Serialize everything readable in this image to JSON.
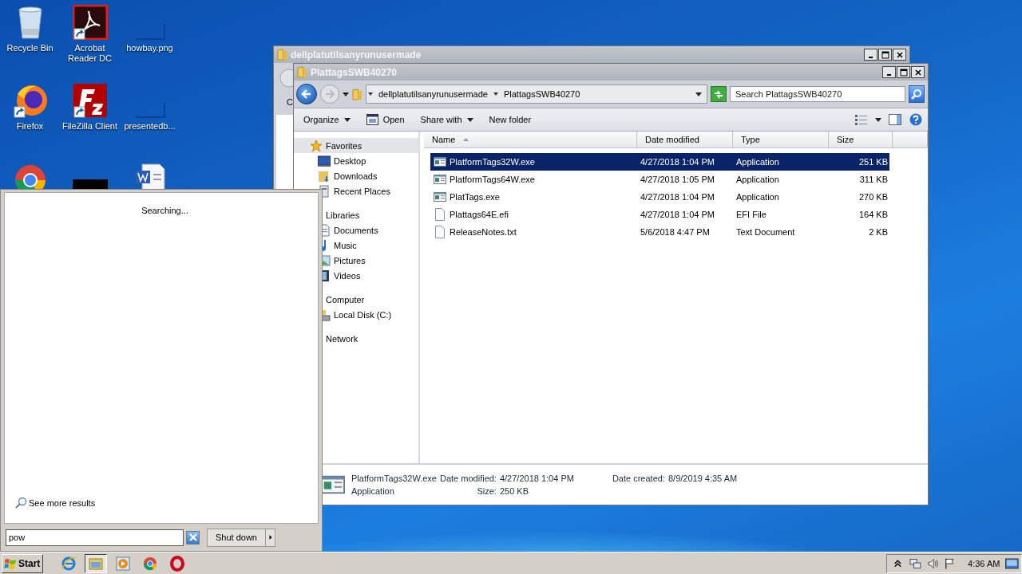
{
  "desktop": {
    "icons": [
      {
        "kind": "recycle",
        "label": "Recycle Bin"
      },
      {
        "kind": "acrobat",
        "label": "Acrobat Reader DC"
      },
      {
        "kind": "blank",
        "label": "howbay.png"
      },
      {
        "kind": "firefox",
        "label": "Firefox"
      },
      {
        "kind": "filezilla",
        "label": "FileZilla Client"
      },
      {
        "kind": "blank",
        "label": "presentedb..."
      },
      {
        "kind": "chrome"
      },
      {
        "kind": "black"
      },
      {
        "kind": "word"
      }
    ]
  },
  "back_window": {
    "title": "dellplatutilsanyrunusermade",
    "toolbar_fragment": "C"
  },
  "explorer": {
    "title": "PlattagsSWB40270",
    "breadcrumb": [
      "dellplatutilsanyrunusermade",
      "PlattagsSWB40270"
    ],
    "search": {
      "placeholder": "Search PlattagsSWB40270"
    },
    "toolbar": [
      {
        "label": "Organize",
        "kind": "dropdown"
      },
      {
        "label": "Open",
        "kind": "open"
      },
      {
        "label": "Share with",
        "kind": "dropdown"
      },
      {
        "label": "New folder",
        "kind": "plain"
      }
    ],
    "nav": [
      {
        "label": "Favorites",
        "kind": "favorites",
        "selected": true,
        "children": [
          {
            "label": "Desktop",
            "kind": "desktop"
          },
          {
            "label": "Downloads",
            "kind": "downloads"
          },
          {
            "label": "Recent Places",
            "kind": "recent"
          }
        ]
      },
      {
        "label": "Libraries",
        "kind": "plain",
        "selected": false,
        "children": [
          {
            "label": "Documents",
            "kind": "documents"
          },
          {
            "label": "Music",
            "kind": "music"
          },
          {
            "label": "Pictures",
            "kind": "pictures"
          },
          {
            "label": "Videos",
            "kind": "videos"
          }
        ]
      },
      {
        "label": "Computer",
        "kind": "plain",
        "selected": false,
        "children": [
          {
            "label": "Local Disk (C:)",
            "kind": "disk"
          }
        ]
      },
      {
        "label": "Network",
        "kind": "plain",
        "selected": false
      }
    ],
    "columns": [
      "Name",
      "Date modified",
      "Type",
      "Size"
    ],
    "rows": [
      {
        "kind": "exe",
        "name": "PlatformTags32W.exe",
        "date": "4/27/2018 1:04 PM",
        "type": "Application",
        "size": "251 KB",
        "selected": true
      },
      {
        "kind": "exe",
        "name": "PlatformTags64W.exe",
        "date": "4/27/2018 1:05 PM",
        "type": "Application",
        "size": "311 KB",
        "selected": false
      },
      {
        "kind": "exe",
        "name": "PlatTags.exe",
        "date": "4/27/2018 1:04 PM",
        "type": "Application",
        "size": "270 KB",
        "selected": false
      },
      {
        "kind": "file",
        "name": "Plattags64E.efi",
        "date": "4/27/2018 1:04 PM",
        "type": "EFI File",
        "size": "164 KB",
        "selected": false
      },
      {
        "kind": "file",
        "name": "ReleaseNotes.txt",
        "date": "5/6/2018 4:47 PM",
        "type": "Text Document",
        "size": "2 KB",
        "selected": false
      }
    ],
    "details": {
      "name": "PlatformTags32W.exe",
      "type": "Application",
      "fields": [
        {
          "label": "Date modified:",
          "value": "4/27/2018 1:04 PM"
        },
        {
          "label": "Date created:",
          "value": "8/9/2019 4:35 AM"
        },
        {
          "label": "Size:",
          "value": "250 KB"
        }
      ]
    }
  },
  "start_menu": {
    "status": "Searching...",
    "see_more": "See more results",
    "search_value": "pow",
    "shutdown": "Shut down"
  },
  "taskbar": {
    "start": "Start",
    "apps": [
      {
        "kind": "ie",
        "selected": false
      },
      {
        "kind": "explorer",
        "selected": true
      },
      {
        "kind": "media",
        "selected": false
      },
      {
        "kind": "chrome",
        "selected": false
      },
      {
        "kind": "opera",
        "selected": false
      }
    ],
    "clock": "4:36 AM"
  }
}
